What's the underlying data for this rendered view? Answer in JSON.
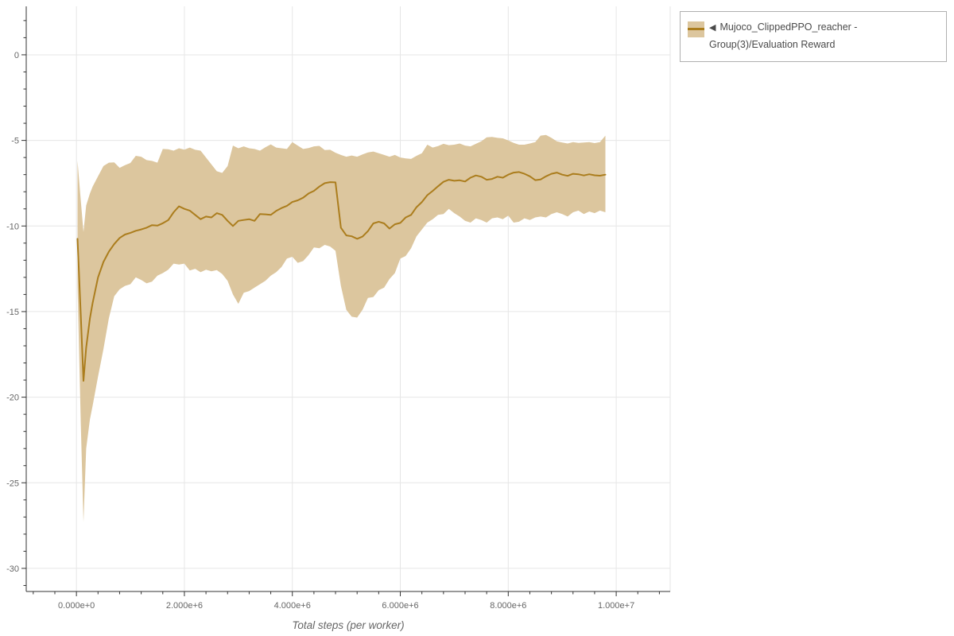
{
  "chart_data": {
    "type": "line",
    "title": "",
    "xlabel": "Total steps (per worker)",
    "ylabel": "",
    "x_unit": "steps (millions)",
    "grid": "major",
    "legend_position": "top-right-outside",
    "xlim": [
      -0.93,
      11.0
    ],
    "ylim": [
      -31.35,
      2.83
    ],
    "x_ticks": {
      "values": [
        0,
        2,
        4,
        6,
        8,
        10
      ],
      "labels": [
        "0.000e+0",
        "2.000e+6",
        "4.000e+6",
        "6.000e+6",
        "8.000e+6",
        "1.000e+7"
      ],
      "minor_step": 0.4
    },
    "y_ticks": {
      "values": [
        0,
        -5,
        -10,
        -15,
        -20,
        -25,
        -30
      ],
      "labels": [
        "0",
        "-5",
        "-10",
        "-15",
        "-20",
        "-25",
        "-30"
      ],
      "minor_step": 1
    },
    "x": [
      0.02,
      0.08,
      0.13,
      0.18,
      0.25,
      0.3,
      0.4,
      0.5,
      0.6,
      0.7,
      0.8,
      0.9,
      1.0,
      1.1,
      1.2,
      1.3,
      1.4,
      1.5,
      1.6,
      1.7,
      1.8,
      1.9,
      2.0,
      2.1,
      2.2,
      2.3,
      2.4,
      2.5,
      2.6,
      2.7,
      2.8,
      2.9,
      3.0,
      3.1,
      3.2,
      3.3,
      3.4,
      3.5,
      3.6,
      3.7,
      3.8,
      3.9,
      4.0,
      4.1,
      4.2,
      4.3,
      4.4,
      4.5,
      4.6,
      4.7,
      4.8,
      4.9,
      5.0,
      5.1,
      5.2,
      5.3,
      5.4,
      5.5,
      5.6,
      5.7,
      5.8,
      5.9,
      6.0,
      6.1,
      6.2,
      6.3,
      6.4,
      6.5,
      6.6,
      6.7,
      6.8,
      6.9,
      7.0,
      7.1,
      7.2,
      7.3,
      7.4,
      7.5,
      7.6,
      7.7,
      7.8,
      7.9,
      8.0,
      8.1,
      8.2,
      8.3,
      8.4,
      8.5,
      8.6,
      8.7,
      8.8,
      8.9,
      9.0,
      9.1,
      9.2,
      9.3,
      9.4,
      9.5,
      9.6,
      9.7,
      9.8
    ],
    "series": [
      {
        "name": "Mujoco_ClippedPPO_reacher - Group(3)/Evaluation Reward",
        "values": [
          -10.75,
          -15.2,
          -19.05,
          -17.1,
          -15.4,
          -14.5,
          -13.0,
          -12.1,
          -11.5,
          -11.05,
          -10.7,
          -10.5,
          -10.4,
          -10.28,
          -10.2,
          -10.1,
          -9.95,
          -9.98,
          -9.84,
          -9.66,
          -9.2,
          -8.85,
          -9.0,
          -9.1,
          -9.35,
          -9.6,
          -9.45,
          -9.5,
          -9.25,
          -9.35,
          -9.7,
          -10.0,
          -9.7,
          -9.65,
          -9.6,
          -9.7,
          -9.3,
          -9.32,
          -9.35,
          -9.12,
          -8.95,
          -8.82,
          -8.6,
          -8.5,
          -8.35,
          -8.1,
          -7.95,
          -7.7,
          -7.5,
          -7.44,
          -7.45,
          -10.1,
          -10.55,
          -10.6,
          -10.75,
          -10.62,
          -10.3,
          -9.85,
          -9.75,
          -9.85,
          -10.15,
          -9.9,
          -9.82,
          -9.5,
          -9.35,
          -8.9,
          -8.6,
          -8.2,
          -7.95,
          -7.68,
          -7.42,
          -7.3,
          -7.36,
          -7.33,
          -7.4,
          -7.18,
          -7.05,
          -7.12,
          -7.3,
          -7.25,
          -7.12,
          -7.18,
          -7.0,
          -6.88,
          -6.85,
          -6.95,
          -7.1,
          -7.32,
          -7.28,
          -7.1,
          -6.95,
          -6.88,
          -7.0,
          -7.07,
          -6.95,
          -6.98,
          -7.05,
          -6.98,
          -7.04,
          -7.06,
          -7.0
        ]
      }
    ],
    "band": {
      "upper": [
        -6.2,
        -8.5,
        -10.35,
        -8.8,
        -8.1,
        -7.7,
        -7.1,
        -6.5,
        -6.3,
        -6.28,
        -6.6,
        -6.45,
        -6.32,
        -5.9,
        -5.95,
        -6.15,
        -6.2,
        -6.3,
        -5.5,
        -5.52,
        -5.6,
        -5.46,
        -5.54,
        -5.42,
        -5.55,
        -5.6,
        -6.0,
        -6.4,
        -6.8,
        -6.9,
        -6.5,
        -5.3,
        -5.46,
        -5.35,
        -5.46,
        -5.5,
        -5.6,
        -5.4,
        -5.23,
        -5.42,
        -5.46,
        -5.5,
        -5.1,
        -5.3,
        -5.5,
        -5.45,
        -5.35,
        -5.32,
        -5.56,
        -5.55,
        -5.72,
        -5.85,
        -5.95,
        -5.88,
        -5.95,
        -5.82,
        -5.7,
        -5.65,
        -5.75,
        -5.85,
        -5.95,
        -5.85,
        -6.0,
        -6.05,
        -6.08,
        -5.9,
        -5.75,
        -5.25,
        -5.42,
        -5.33,
        -5.2,
        -5.28,
        -5.25,
        -5.18,
        -5.3,
        -5.35,
        -5.2,
        -5.05,
        -4.82,
        -4.8,
        -4.85,
        -4.88,
        -5.0,
        -5.15,
        -5.25,
        -5.25,
        -5.18,
        -5.1,
        -4.72,
        -4.68,
        -4.85,
        -5.05,
        -5.12,
        -5.18,
        -5.1,
        -5.15,
        -5.12,
        -5.1,
        -5.16,
        -5.1,
        -4.72
      ],
      "lower": [
        -13.5,
        -21.5,
        -27.3,
        -23.0,
        -21.3,
        -20.5,
        -18.8,
        -17.2,
        -15.4,
        -14.1,
        -13.7,
        -13.5,
        -13.4,
        -13.0,
        -13.15,
        -13.35,
        -13.25,
        -12.9,
        -12.75,
        -12.55,
        -12.2,
        -12.25,
        -12.2,
        -12.6,
        -12.5,
        -12.7,
        -12.55,
        -12.65,
        -12.58,
        -12.8,
        -13.2,
        -14.0,
        -14.55,
        -13.9,
        -13.8,
        -13.6,
        -13.4,
        -13.2,
        -12.9,
        -12.7,
        -12.4,
        -11.9,
        -11.8,
        -12.15,
        -12.05,
        -11.7,
        -11.25,
        -11.3,
        -11.1,
        -11.2,
        -11.45,
        -13.5,
        -14.9,
        -15.3,
        -15.35,
        -14.9,
        -14.2,
        -14.15,
        -13.75,
        -13.6,
        -13.1,
        -12.75,
        -11.9,
        -11.75,
        -11.3,
        -10.6,
        -10.2,
        -9.8,
        -9.6,
        -9.35,
        -9.3,
        -9.0,
        -9.25,
        -9.45,
        -9.7,
        -9.8,
        -9.55,
        -9.65,
        -9.8,
        -9.55,
        -9.5,
        -9.6,
        -9.4,
        -9.8,
        -9.75,
        -9.55,
        -9.65,
        -9.5,
        -9.45,
        -9.5,
        -9.3,
        -9.2,
        -9.3,
        -9.45,
        -9.2,
        -9.1,
        -9.3,
        -9.15,
        -9.25,
        -9.1,
        -9.2
      ]
    }
  },
  "legend": {
    "arrow": "◀",
    "label": "Mujoco_ClippedPPO_reacher - Group(3)/Evaluation Reward"
  },
  "colors": {
    "band": "#dcc69e",
    "line": "#ab7d1d",
    "grid": "#e6e6e6",
    "plot_border": "#e6e6e6",
    "axis": "#333333",
    "tick_label": "#666666",
    "axis_title": "#666666",
    "legend_border": "#b0b0b0",
    "legend_text": "#4a4a4a",
    "background": "#ffffff"
  }
}
